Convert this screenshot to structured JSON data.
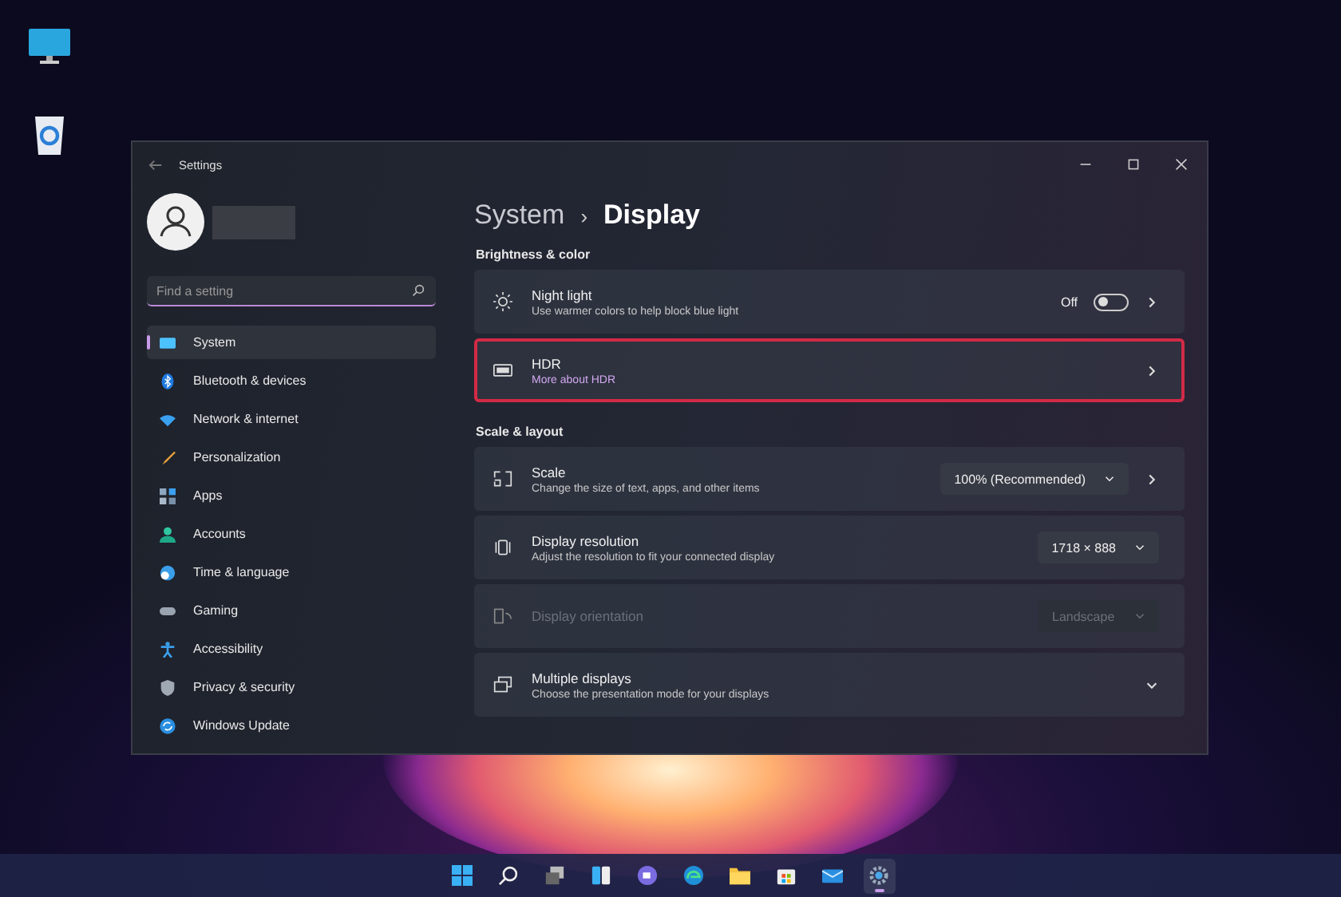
{
  "window": {
    "title": "Settings"
  },
  "sidebar": {
    "search": {
      "placeholder": "Find a setting"
    },
    "items": [
      {
        "label": "System",
        "selected": true
      },
      {
        "label": "Bluetooth & devices",
        "selected": false
      },
      {
        "label": "Network & internet",
        "selected": false
      },
      {
        "label": "Personalization",
        "selected": false
      },
      {
        "label": "Apps",
        "selected": false
      },
      {
        "label": "Accounts",
        "selected": false
      },
      {
        "label": "Time & language",
        "selected": false
      },
      {
        "label": "Gaming",
        "selected": false
      },
      {
        "label": "Accessibility",
        "selected": false
      },
      {
        "label": "Privacy & security",
        "selected": false
      },
      {
        "label": "Windows Update",
        "selected": false
      }
    ]
  },
  "breadcrumb": {
    "parent": "System",
    "separator": "›",
    "current": "Display"
  },
  "sections": [
    {
      "heading": "Brightness & color",
      "rows": [
        {
          "kind": "toggle",
          "title": "Night light",
          "subtitle": "Use warmer colors to help block blue light",
          "state_label": "Off",
          "on": false,
          "chevron": true,
          "disabled": false,
          "highlighted": false
        },
        {
          "kind": "link",
          "title": "HDR",
          "subtitle": "More about HDR",
          "chevron": true,
          "disabled": false,
          "highlighted": true
        }
      ]
    },
    {
      "heading": "Scale & layout",
      "rows": [
        {
          "kind": "dropdown",
          "title": "Scale",
          "subtitle": "Change the size of text, apps, and other items",
          "value": "100% (Recommended)",
          "chevron": true,
          "disabled": false,
          "highlighted": false
        },
        {
          "kind": "dropdown",
          "title": "Display resolution",
          "subtitle": "Adjust the resolution to fit your connected display",
          "value": "1718 × 888",
          "chevron": false,
          "disabled": false,
          "highlighted": false
        },
        {
          "kind": "dropdown",
          "title": "Display orientation",
          "value": "Landscape",
          "chevron": false,
          "disabled": true,
          "highlighted": false
        },
        {
          "kind": "expander",
          "title": "Multiple displays",
          "subtitle": "Choose the presentation mode for your displays",
          "expanded": false,
          "chevron": false,
          "disabled": false,
          "highlighted": false
        }
      ]
    }
  ],
  "taskbar": {
    "items": [
      {
        "selected": false
      },
      {
        "selected": false
      },
      {
        "selected": false
      },
      {
        "selected": false
      },
      {
        "selected": false
      },
      {
        "selected": false
      },
      {
        "selected": false
      },
      {
        "selected": false
      },
      {
        "selected": false
      },
      {
        "selected": true
      }
    ]
  }
}
